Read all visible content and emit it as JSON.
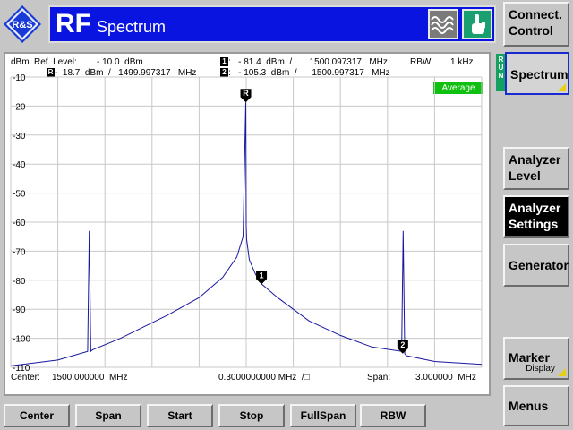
{
  "header": {
    "app_title": "RF",
    "screen_title": "Spectrum",
    "logo_text": "R&S"
  },
  "softkeys": [
    {
      "label_line1": "Connect.",
      "label_line2": "Control"
    },
    {
      "label_line1": "Spectrum",
      "label_line2": "",
      "run_text": "RUN"
    },
    {
      "label_line1": "Analyzer",
      "label_line2": "Level"
    },
    {
      "label_line1": "Analyzer",
      "label_line2": "Settings"
    },
    {
      "label_line1": "Generator",
      "label_line2": ""
    },
    {
      "label_line1": "Marker",
      "label_line2": "",
      "sub_label": "Display"
    },
    {
      "label_line1": "Menus",
      "label_line2": ""
    }
  ],
  "plot_header": {
    "unit": "dBm",
    "ref_level_label": "Ref. Level:",
    "ref_level_value": "- 10.0  dBm",
    "ref_marker_label": "R",
    "ref_marker_readout": "-  18.7  dBm  /   1499.997317   MHz",
    "m1_label": "1",
    "m1_readout": ":   - 81.4  dBm  /       1500.097317   MHz",
    "m2_label": "2",
    "m2_readout": ":   - 105.3  dBm  /      1500.997317   MHz",
    "rbw_label": "RBW",
    "rbw_value": "1 kHz",
    "detector_badge": "Average"
  },
  "footer": {
    "center_label": "Center:",
    "center_value": "1500.000000  MHz",
    "div_value": "0.3000000000 MHz  /□",
    "span_label": "Span:",
    "span_value": "3.000000  MHz"
  },
  "bottom_buttons": [
    "Center",
    "Span",
    "Start",
    "Stop",
    "FullSpan",
    "RBW"
  ],
  "colors": {
    "title_bar": "#0a14e0",
    "trace": "#1818a0",
    "average_badge": "#10c010",
    "run_strip": "#14a060"
  },
  "chart_data": {
    "type": "line",
    "title": "",
    "xlabel": "",
    "ylabel": "dBm",
    "xlim": [
      1498.5,
      1501.5
    ],
    "ylim": [
      -110,
      -10
    ],
    "x_unit": "MHz",
    "yticks": [
      -10,
      -20,
      -30,
      -40,
      -50,
      -60,
      -70,
      -80,
      -90,
      -100,
      -110
    ],
    "grid": true,
    "series": [
      {
        "x": [
          1498.5,
          1498.8,
          1498.99,
          1499.0,
          1499.01,
          1499.02,
          1499.2,
          1499.5,
          1499.7,
          1499.85,
          1499.94,
          1499.98,
          1499.997,
          1500.0,
          1500.003,
          1500.02,
          1500.06,
          1500.1,
          1500.2,
          1500.4,
          1500.6,
          1500.8,
          1500.99,
          1501.0,
          1501.01,
          1501.02,
          1501.2,
          1501.5
        ],
        "y": [
          -109.5,
          -107.5,
          -104.5,
          -63,
          -104.5,
          -104,
          -100,
          -92,
          -86,
          -79,
          -72,
          -65,
          -18.7,
          -61,
          -66,
          -73,
          -78,
          -81.4,
          -86,
          -94,
          -99,
          -103,
          -104.5,
          -63,
          -105.3,
          -106,
          -108,
          -109
        ]
      }
    ],
    "markers": [
      {
        "label": "R",
        "x": 1499.997317,
        "y": -18.7
      },
      {
        "label": "1",
        "x": 1500.097317,
        "y": -81.4
      },
      {
        "label": "2",
        "x": 1500.997317,
        "y": -105.3
      }
    ]
  }
}
